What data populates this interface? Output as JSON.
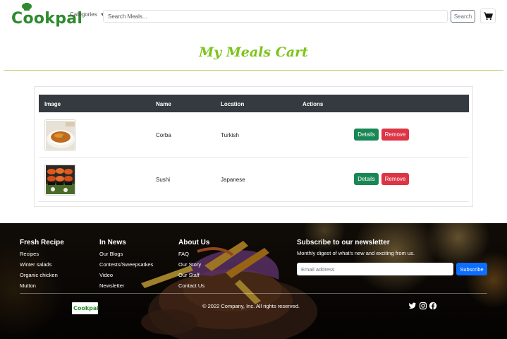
{
  "brand": {
    "logo_text": "Cookpal",
    "primary_color": "#2e8b2e"
  },
  "navbar": {
    "categories_label": "Categories",
    "search_placeholder": "Search Meals...",
    "search_label": "Search",
    "cart_icon": "cart-icon"
  },
  "page": {
    "title": "My Meals Cart",
    "title_color": "#7cc41a"
  },
  "table": {
    "headers": [
      "Image",
      "Name",
      "Location",
      "Actions"
    ],
    "rows": [
      {
        "image": "corba-thumbnail",
        "name": "Corba",
        "location": "Turkish",
        "details_label": "Details",
        "remove_label": "Remove"
      },
      {
        "image": "sushi-thumbnail",
        "name": "Sushi",
        "location": "Japanese",
        "details_label": "Details",
        "remove_label": "Remove"
      }
    ],
    "header_bg": "#343a40",
    "details_color": "#198754",
    "remove_color": "#dc3545"
  },
  "footer": {
    "columns": [
      {
        "title": "Fresh Recipe",
        "links": [
          "Recipes",
          "Winter salads",
          "Organic chicken",
          "Mutton"
        ]
      },
      {
        "title": "In News",
        "links": [
          "Our Blogs",
          "Contests/Sweepsatkes",
          "Video",
          "Newsletter"
        ]
      },
      {
        "title": "About Us",
        "links": [
          "FAQ",
          "Our Story",
          "Our Staff",
          "Contact Us"
        ]
      }
    ],
    "newsletter": {
      "title": "Subscribe to our newsletter",
      "subtitle": "Monthly digest of what's new and exciting from us.",
      "email_placeholder": "Email address",
      "subscribe_label": "Subscribe",
      "button_color": "#0d6efd"
    },
    "logo_text": "Cookpal",
    "copyright": "© 2022 Company, Inc. All rights reserved.",
    "social_icons": [
      "twitter-icon",
      "instagram-icon",
      "facebook-icon"
    ]
  }
}
